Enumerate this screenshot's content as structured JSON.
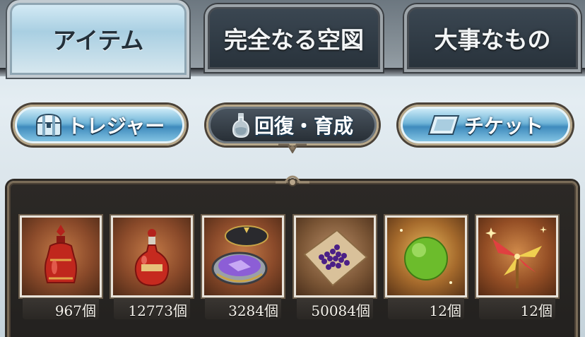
{
  "tabs": [
    {
      "label": "アイテム",
      "active": true
    },
    {
      "label": "完全なる空図",
      "active": false
    },
    {
      "label": "大事なもの",
      "active": false
    }
  ],
  "filters": [
    {
      "label": "トレジャー",
      "icon": "treasure-chest-icon",
      "active": false
    },
    {
      "label": "回復・育成",
      "icon": "potion-bottle-icon",
      "active": true
    },
    {
      "label": "チケット",
      "icon": "ticket-icon",
      "active": false
    }
  ],
  "items": [
    {
      "icon": "large-red-elixir-icon",
      "count": "967個"
    },
    {
      "icon": "red-potion-icon",
      "count": "12773個"
    },
    {
      "icon": "soul-seed-tin-icon",
      "count": "3284個"
    },
    {
      "icon": "purple-berries-cloth-icon",
      "count": "50084個"
    },
    {
      "icon": "green-orb-icon",
      "count": "12個"
    },
    {
      "icon": "golden-pinwheel-icon",
      "count": "12個"
    }
  ],
  "colors": {
    "active_tab": "#a9cfe2",
    "inactive_tab": "#28323b",
    "filter_blue": "#3f8bbd",
    "panel_bg": "#23211f",
    "item_frame_bg": "#8a4a2a"
  }
}
